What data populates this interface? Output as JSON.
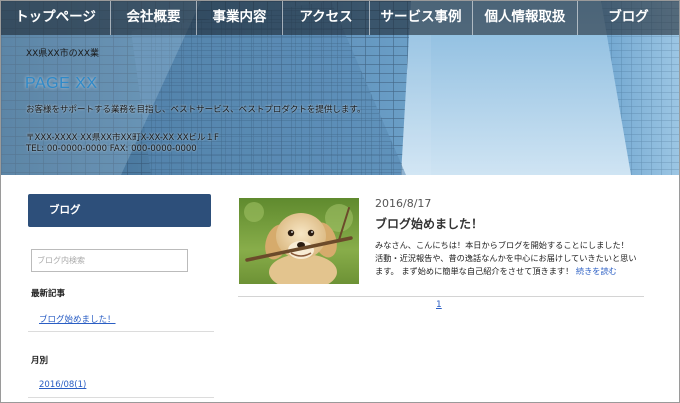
{
  "nav": {
    "items": [
      {
        "label": "トップページ"
      },
      {
        "label": "会社概要"
      },
      {
        "label": "事業内容"
      },
      {
        "label": "アクセス"
      },
      {
        "label": "サービス事例"
      },
      {
        "label": "個人情報取扱"
      },
      {
        "label": "ブログ"
      }
    ]
  },
  "hero": {
    "address_top": "XX県XX市のXX業",
    "site_title": "PAGE XX",
    "description": "お客様をサポートする業務を目指し、ベストサービス、ベストプロダクトを提供します。",
    "address": "〒XXX-XXXX XX県XX市XX町X-XX-XX XXビル１F",
    "tel": "TEL: 00-0000-0000 FAX: 000-0000-0000"
  },
  "sidebar": {
    "header": "ブログ",
    "search_placeholder": "ブログ内検索",
    "recent_label": "最新記事",
    "recent_posts": [
      "ブログ始めました！"
    ],
    "monthly_label": "月別",
    "months": [
      "2016/08(1)"
    ]
  },
  "post": {
    "date": "2016/8/17",
    "title": "ブログ始めました！",
    "excerpt": "みなさん、こんにちは！本日からブログを開始することにしました！ 活動・近況報告や、昔の逸話なんかを中心にお届けしていきたいと思います。 まず始めに簡単な自己紹介をさせて頂きます！",
    "read_more": "続きを読む",
    "image_icon": "puppy-photo"
  },
  "pagination": {
    "current": "1"
  },
  "colors": {
    "nav_bg": "#26303a",
    "sidebar_header": "#2d4f7a",
    "link": "#2a5ec4",
    "site_title": "#2e89c8"
  }
}
